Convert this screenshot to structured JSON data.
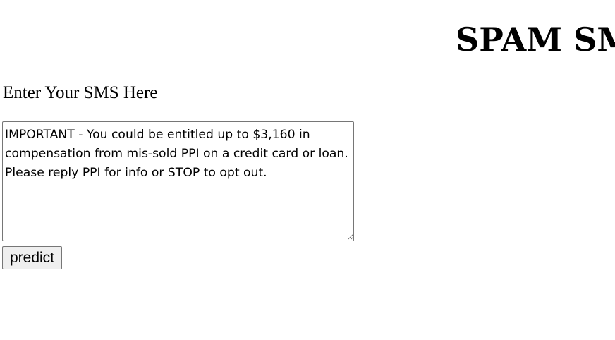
{
  "header": {
    "title": "SPAM SMS"
  },
  "form": {
    "label": "Enter Your SMS Here",
    "sms_value": "IMPORTANT - You could be entitled up to $3,160 in compensation from mis-sold PPI on a credit card or loan. Please reply PPI for info or STOP to opt out.",
    "predict_label": "predict"
  }
}
